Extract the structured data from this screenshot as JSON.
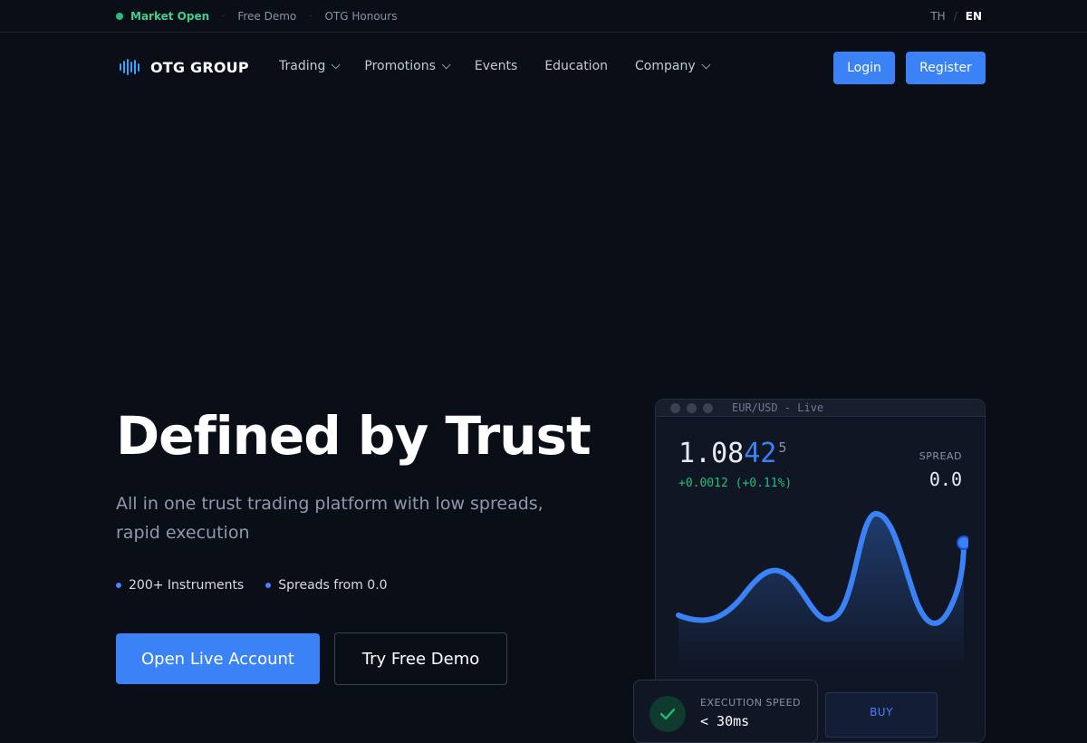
{
  "topbar": {
    "status": "Market Open",
    "links": [
      "Free Demo",
      "OTG Honours"
    ],
    "lang": {
      "th": "TH",
      "sep": "/",
      "en": "EN"
    }
  },
  "nav": {
    "brand": "OTG GROUP",
    "menu": [
      {
        "label": "Trading",
        "dropdown": true
      },
      {
        "label": "Promotions",
        "dropdown": true
      },
      {
        "label": "Events",
        "dropdown": false
      },
      {
        "label": "Education",
        "dropdown": false
      },
      {
        "label": "Company",
        "dropdown": true
      }
    ],
    "login": "Login",
    "register": "Register"
  },
  "hero": {
    "title": "Defined by Trust",
    "subtitle": "All in one trust trading platform with low spreads, rapid execution",
    "features": [
      "200+ Instruments",
      "Spreads from 0.0"
    ],
    "cta_primary": "Open Live Account",
    "cta_secondary": "Try Free Demo"
  },
  "widget": {
    "title": "EUR/USD - Live",
    "price_main": "1.08",
    "price_highlight": "42",
    "price_pip": "5",
    "change": "+0.0012 (+0.11%)",
    "spread_label": "SPREAD",
    "spread_value": "0.0",
    "exec_label": "EXECUTION SPEED",
    "exec_value": "< 30ms",
    "buy_label": "BUY"
  },
  "colors": {
    "accent": "#3b82f6",
    "positive": "#22c07a",
    "background": "#0a0e17"
  }
}
